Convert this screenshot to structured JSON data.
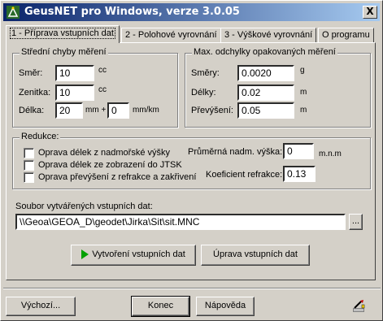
{
  "window": {
    "title": "GeusNET pro Windows, verze 3.0.05",
    "close_label": "X"
  },
  "tabs": [
    {
      "label": "1 - Příprava vstupních dat"
    },
    {
      "label": "2 - Polohové vyrovnání"
    },
    {
      "label": "3 - Výškové vyrovnání"
    },
    {
      "label": "O programu"
    }
  ],
  "stredni": {
    "title": "Střední chyby měření",
    "smer_label": "Směr:",
    "smer_value": "10",
    "smer_unit": "cc",
    "zenitka_label": "Zenitka:",
    "zenitka_value": "10",
    "zenitka_unit": "cc",
    "delka_label": "Délka:",
    "delka_value1": "20",
    "delka_mid": "mm +",
    "delka_value2": "0",
    "delka_unit": "mm/km"
  },
  "max": {
    "title": "Max. odchylky opakovaných měření",
    "smery_label": "Směry:",
    "smery_value": "0.0020",
    "smery_unit": "g",
    "delky_label": "Délky:",
    "delky_value": "0.02",
    "delky_unit": "m",
    "prev_label": "Převýšení:",
    "prev_value": "0.05",
    "prev_unit": "m"
  },
  "redukce": {
    "title": "Redukce:",
    "chk1": "Oprava délek z nadmořské výšky",
    "chk2": "Oprava délek ze zobrazení do JTSK",
    "chk3": "Oprava převýšení z refrakce a zakřivení",
    "vyska_label": "Průměrná nadm. výška:",
    "vyska_value": "0",
    "vyska_unit": "m.n.m",
    "refr_label": "Koeficient refrakce:",
    "refr_value": "0.13"
  },
  "soubor": {
    "label": "Soubor vytvářených vstupních dat:",
    "path": "\\\\Geoa\\GEOA_D\\geodet\\Jirka\\Sit\\sit.MNC",
    "browse_label": "..."
  },
  "actions": {
    "create_label": "Vytvoření vstupních dat",
    "edit_label": "Úprava vstupních dat"
  },
  "footer": {
    "default_label": "Výchozí...",
    "end_label": "Konec",
    "help_label": "Nápověda"
  }
}
